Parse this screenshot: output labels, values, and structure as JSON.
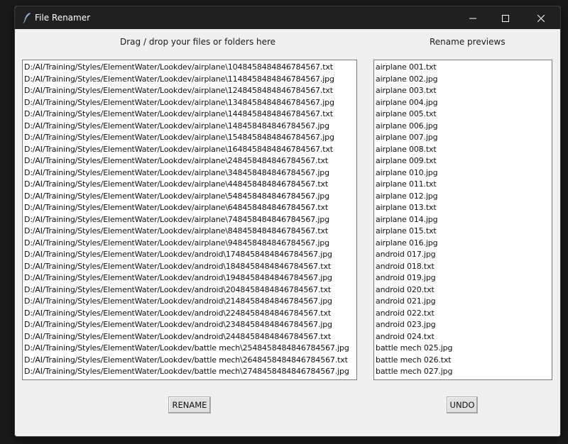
{
  "window": {
    "title": "File Renamer",
    "controls": {
      "minimize": "minimize",
      "maximize": "maximize",
      "close": "close"
    }
  },
  "headers": {
    "left": "Drag / drop your files or folders here",
    "right": "Rename previews"
  },
  "files": [
    "D:/AI/Training/Styles/ElementWater/Lookdev/airplane\\1048458484846784567.txt",
    "D:/AI/Training/Styles/ElementWater/Lookdev/airplane\\1148458484846784567.jpg",
    "D:/AI/Training/Styles/ElementWater/Lookdev/airplane\\1248458484846784567.txt",
    "D:/AI/Training/Styles/ElementWater/Lookdev/airplane\\1348458484846784567.jpg",
    "D:/AI/Training/Styles/ElementWater/Lookdev/airplane\\1448458484846784567.txt",
    "D:/AI/Training/Styles/ElementWater/Lookdev/airplane\\148458484846784567.jpg",
    "D:/AI/Training/Styles/ElementWater/Lookdev/airplane\\1548458484846784567.jpg",
    "D:/AI/Training/Styles/ElementWater/Lookdev/airplane\\1648458484846784567.txt",
    "D:/AI/Training/Styles/ElementWater/Lookdev/airplane\\248458484846784567.txt",
    "D:/AI/Training/Styles/ElementWater/Lookdev/airplane\\348458484846784567.jpg",
    "D:/AI/Training/Styles/ElementWater/Lookdev/airplane\\448458484846784567.txt",
    "D:/AI/Training/Styles/ElementWater/Lookdev/airplane\\548458484846784567.jpg",
    "D:/AI/Training/Styles/ElementWater/Lookdev/airplane\\648458484846784567.txt",
    "D:/AI/Training/Styles/ElementWater/Lookdev/airplane\\748458484846784567.jpg",
    "D:/AI/Training/Styles/ElementWater/Lookdev/airplane\\848458484846784567.txt",
    "D:/AI/Training/Styles/ElementWater/Lookdev/airplane\\948458484846784567.jpg",
    "D:/AI/Training/Styles/ElementWater/Lookdev/android\\1748458484846784567.jpg",
    "D:/AI/Training/Styles/ElementWater/Lookdev/android\\1848458484846784567.txt",
    "D:/AI/Training/Styles/ElementWater/Lookdev/android\\1948458484846784567.jpg",
    "D:/AI/Training/Styles/ElementWater/Lookdev/android\\2048458484846784567.txt",
    "D:/AI/Training/Styles/ElementWater/Lookdev/android\\2148458484846784567.jpg",
    "D:/AI/Training/Styles/ElementWater/Lookdev/android\\2248458484846784567.txt",
    "D:/AI/Training/Styles/ElementWater/Lookdev/android\\2348458484846784567.jpg",
    "D:/AI/Training/Styles/ElementWater/Lookdev/android\\2448458484846784567.txt",
    "D:/AI/Training/Styles/ElementWater/Lookdev/battle mech\\2548458484846784567.jpg",
    "D:/AI/Training/Styles/ElementWater/Lookdev/battle mech\\2648458484846784567.txt",
    "D:/AI/Training/Styles/ElementWater/Lookdev/battle mech\\2748458484846784567.jpg"
  ],
  "previews": [
    "airplane 001.txt",
    "airplane 002.jpg",
    "airplane 003.txt",
    "airplane 004.jpg",
    "airplane 005.txt",
    "airplane 006.jpg",
    "airplane 007.jpg",
    "airplane 008.txt",
    "airplane 009.txt",
    "airplane 010.jpg",
    "airplane 011.txt",
    "airplane 012.jpg",
    "airplane 013.txt",
    "airplane 014.jpg",
    "airplane 015.txt",
    "airplane 016.jpg",
    "android 017.jpg",
    "android 018.txt",
    "android 019.jpg",
    "android 020.txt",
    "android 021.jpg",
    "android 022.txt",
    "android 023.jpg",
    "android 024.txt",
    "battle mech 025.jpg",
    "battle mech 026.txt",
    "battle mech 027.jpg"
  ],
  "buttons": {
    "rename": "RENAME",
    "undo": "UNDO"
  },
  "colors": {
    "titlebar": "#202020",
    "background": "#f0f0f0",
    "list_bg": "#ffffff"
  }
}
